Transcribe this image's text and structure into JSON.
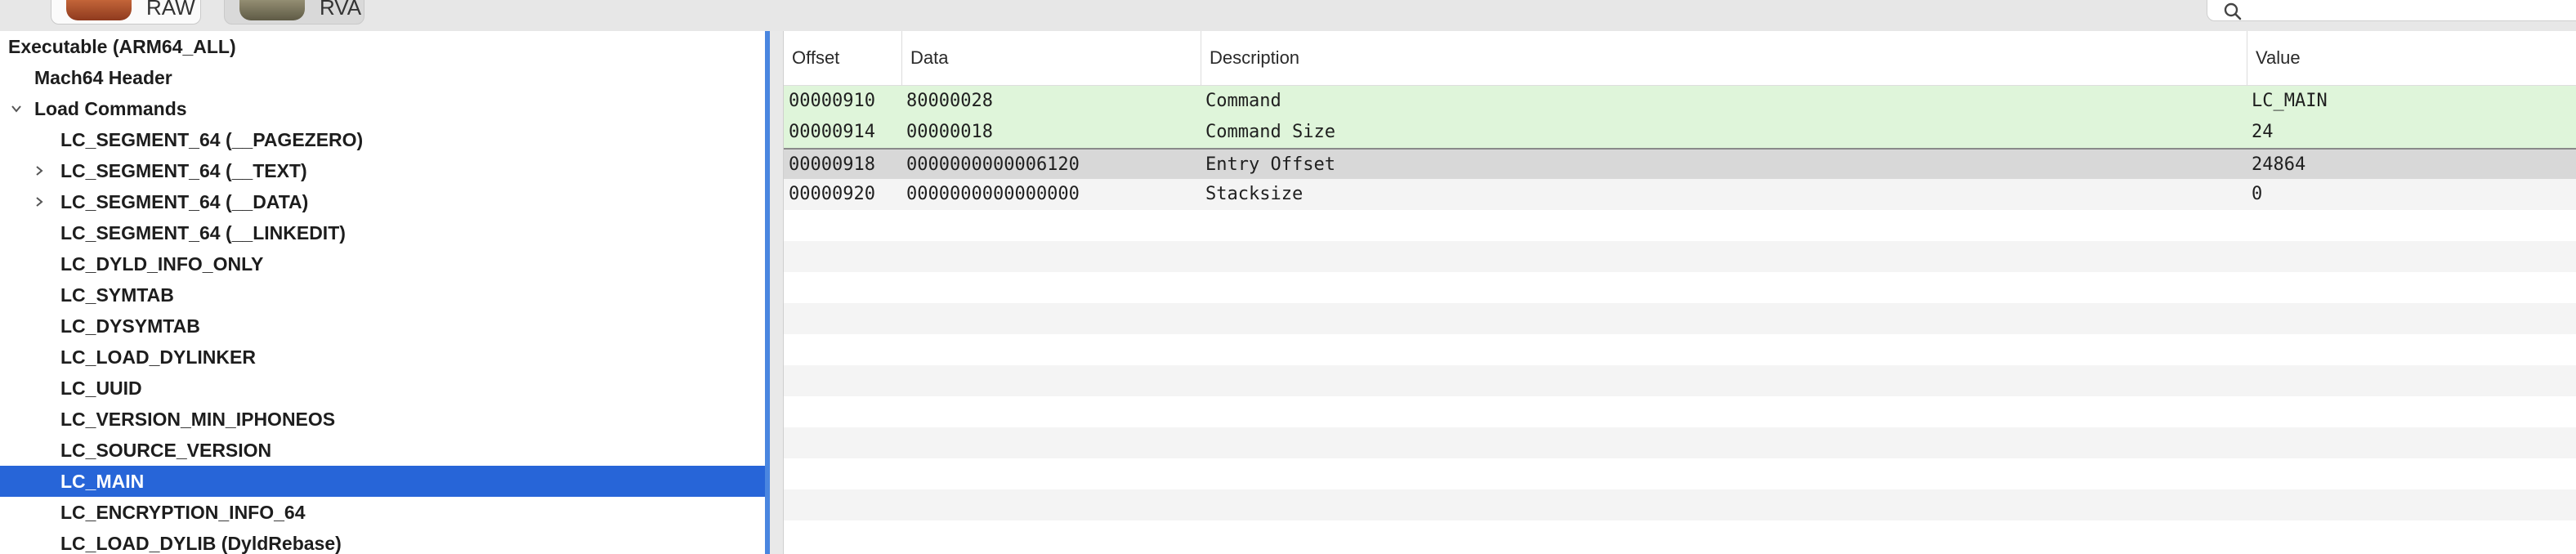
{
  "toolbar": {
    "raw_label": "RAW",
    "rva_label": "RVA",
    "search_placeholder": ""
  },
  "tree": {
    "items": [
      {
        "label": "Executable  (ARM64_ALL)",
        "level": 0,
        "chevron": "none"
      },
      {
        "label": "Mach64 Header",
        "level": 1,
        "chevron": "none"
      },
      {
        "label": "Load Commands",
        "level": 1,
        "chevron": "down"
      },
      {
        "label": "LC_SEGMENT_64 (__PAGEZERO)",
        "level": 2,
        "chevron": "none"
      },
      {
        "label": "LC_SEGMENT_64 (__TEXT)",
        "level": 2,
        "chevron": "right"
      },
      {
        "label": "LC_SEGMENT_64 (__DATA)",
        "level": 2,
        "chevron": "right"
      },
      {
        "label": "LC_SEGMENT_64 (__LINKEDIT)",
        "level": 2,
        "chevron": "none"
      },
      {
        "label": "LC_DYLD_INFO_ONLY",
        "level": 2,
        "chevron": "none"
      },
      {
        "label": "LC_SYMTAB",
        "level": 2,
        "chevron": "none"
      },
      {
        "label": "LC_DYSYMTAB",
        "level": 2,
        "chevron": "none"
      },
      {
        "label": "LC_LOAD_DYLINKER",
        "level": 2,
        "chevron": "none"
      },
      {
        "label": "LC_UUID",
        "level": 2,
        "chevron": "none"
      },
      {
        "label": "LC_VERSION_MIN_IPHONEOS",
        "level": 2,
        "chevron": "none"
      },
      {
        "label": "LC_SOURCE_VERSION",
        "level": 2,
        "chevron": "none"
      },
      {
        "label": "LC_MAIN",
        "level": 2,
        "chevron": "none",
        "selected": true
      },
      {
        "label": "LC_ENCRYPTION_INFO_64",
        "level": 2,
        "chevron": "none"
      },
      {
        "label": "LC_LOAD_DYLIB (DyldRebase)",
        "level": 2,
        "chevron": "none"
      }
    ]
  },
  "table": {
    "columns": {
      "offset": "Offset",
      "data": "Data",
      "description": "Description",
      "value": "Value"
    },
    "rows": [
      {
        "offset": "00000910",
        "data": "80000028",
        "description": "Command",
        "value": "LC_MAIN",
        "style": "green"
      },
      {
        "offset": "00000914",
        "data": "00000018",
        "description": "Command Size",
        "value": "24",
        "style": "green"
      },
      {
        "offset": "00000918",
        "data": "0000000000006120",
        "description": "Entry Offset",
        "value": "24864",
        "style": "sel"
      },
      {
        "offset": "00000920",
        "data": "0000000000000000",
        "description": "Stacksize",
        "value": "0",
        "style": "odd"
      }
    ],
    "empty_rows": 11
  },
  "colors": {
    "selection": "#2765d8",
    "focus_ring": "#4a86e0",
    "highlight_green": "#dff5da",
    "stripe": "#f4f4f4"
  }
}
